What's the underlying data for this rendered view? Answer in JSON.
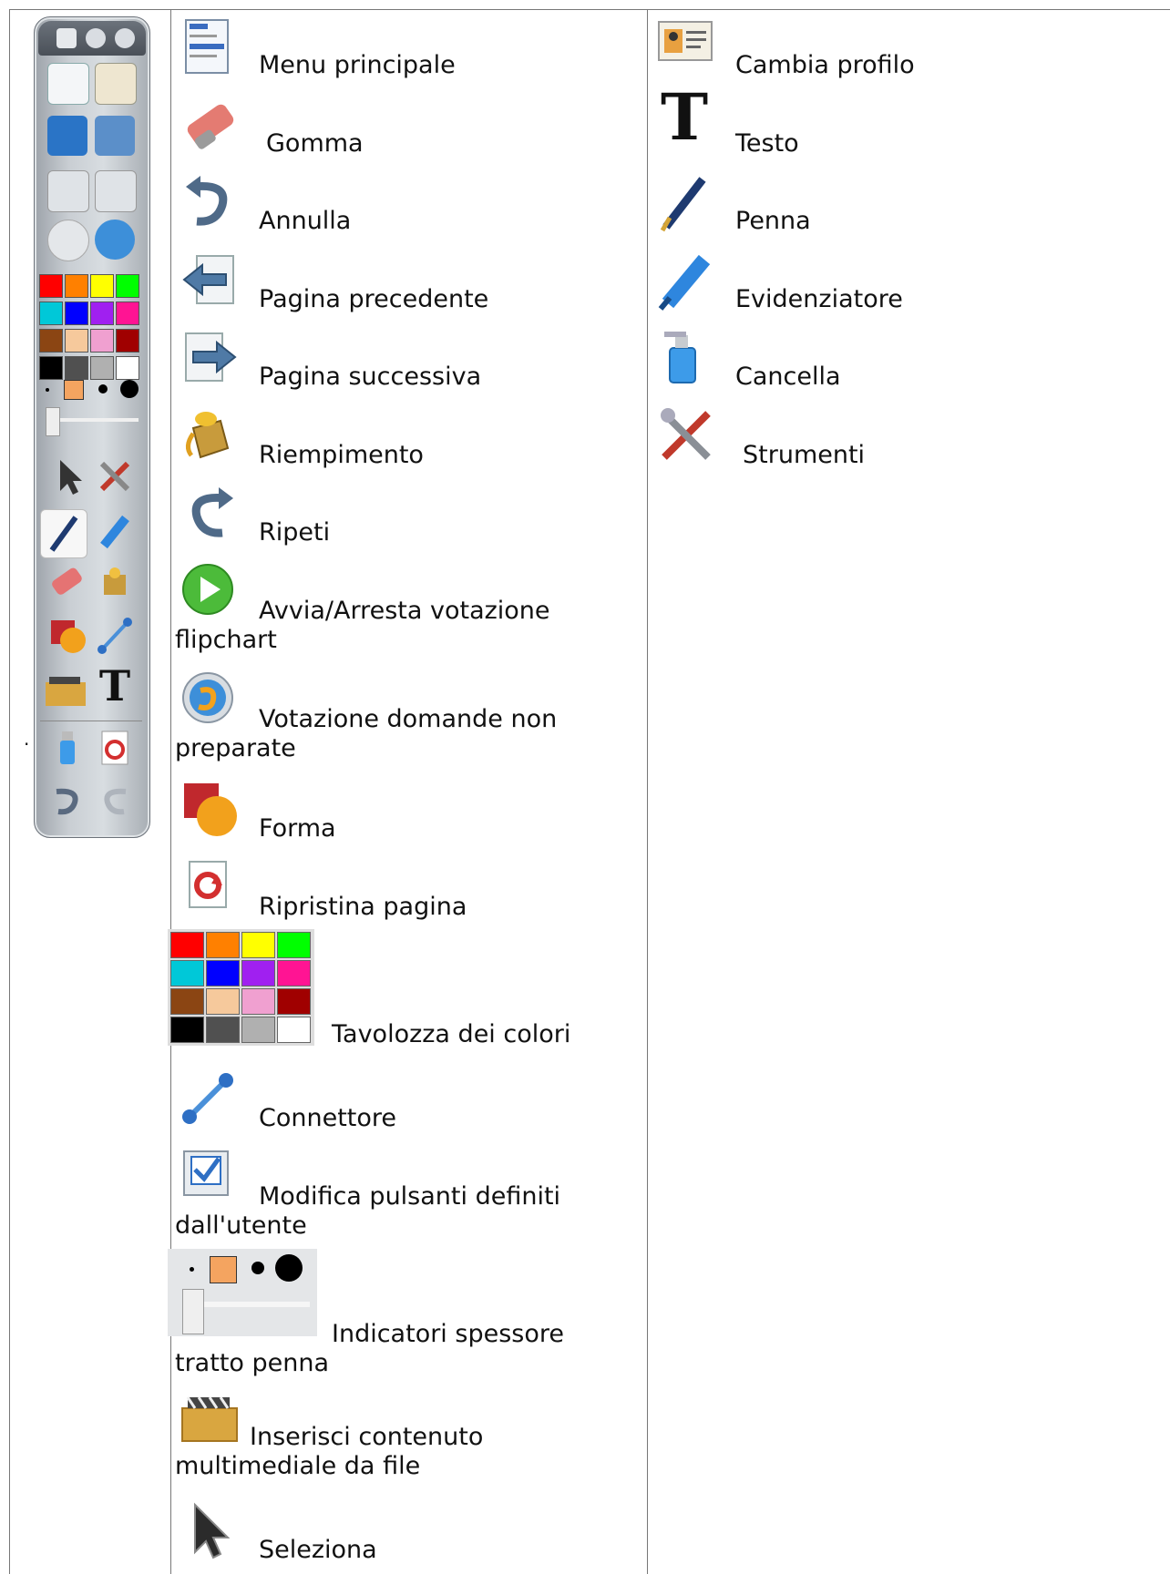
{
  "toolbar": {
    "palette": [
      "#ff0000",
      "#ff8000",
      "#ffff00",
      "#00ff00",
      "#00c8d8",
      "#0000ff",
      "#a020f0",
      "#ff1493",
      "#8b4513",
      "#f6c99c",
      "#f0a0d0",
      "#a00000",
      "#000000",
      "#505050",
      "#b0b0b0",
      "#ffffff"
    ]
  },
  "columns": {
    "middle": [
      {
        "icon": "main-menu-icon",
        "label": "Menu principale"
      },
      {
        "icon": "eraser-icon",
        "label": "Gomma"
      },
      {
        "icon": "undo-icon",
        "label": "Annulla"
      },
      {
        "icon": "previous-page-icon",
        "label": "Pagina precedente"
      },
      {
        "icon": "next-page-icon",
        "label": "Pagina successiva"
      },
      {
        "icon": "fill-bucket-icon",
        "label": "Riempimento"
      },
      {
        "icon": "redo-icon",
        "label": "Ripeti"
      },
      {
        "icon": "play-icon",
        "label": "Avvia/Arresta votazione",
        "label2": "flipchart"
      },
      {
        "icon": "unprepared-vote-icon",
        "label": "Votazione domande non",
        "label2": "preparate"
      },
      {
        "icon": "shape-icon",
        "label": "Forma"
      },
      {
        "icon": "reset-page-icon",
        "label": "Ripristina pagina"
      },
      {
        "icon": "color-palette-icon",
        "label": "Tavolozza dei colori"
      },
      {
        "icon": "connector-icon",
        "label": "Connettore"
      },
      {
        "icon": "checkbox-icon",
        "label": "Modifica pulsanti definiti",
        "label2": "dall'utente"
      },
      {
        "icon": "pen-thickness-icon",
        "label": "Indicatori spessore",
        "label2": "tratto penna"
      },
      {
        "icon": "media-folder-icon",
        "label": "Inserisci contenuto",
        "label2": "multimediale da file"
      },
      {
        "icon": "pointer-icon",
        "label": "Seleziona"
      }
    ],
    "right": [
      {
        "icon": "profile-card-icon",
        "label": "Cambia profilo"
      },
      {
        "icon": "text-icon",
        "label": "Testo",
        "glyph": "T"
      },
      {
        "icon": "pen-icon",
        "label": "Penna"
      },
      {
        "icon": "highlighter-icon",
        "label": "Evidenziatore"
      },
      {
        "icon": "spray-bottle-icon",
        "label": "Cancella"
      },
      {
        "icon": "tools-icon",
        "label": "Strumenti"
      }
    ]
  },
  "stray_mark": "·"
}
